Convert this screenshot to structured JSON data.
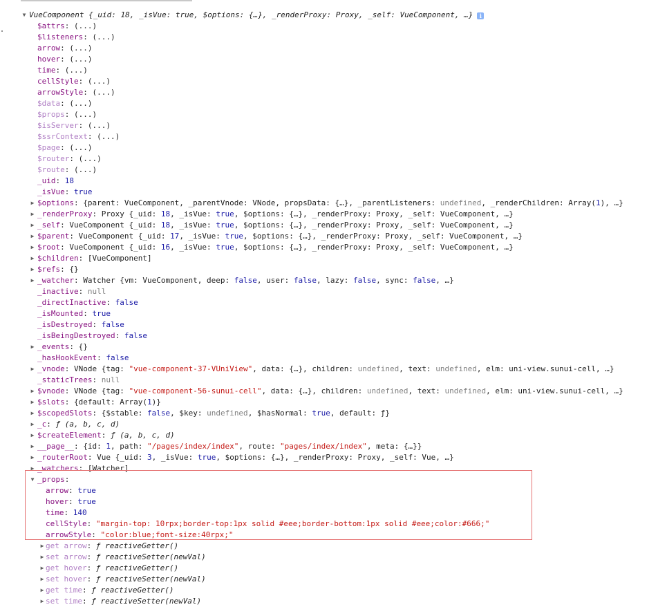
{
  "header": {
    "class_name": "VueComponent",
    "summary_tail": " {_uid: 18, _isVue: true, $options: {…}, _renderProxy: Proxy, _self: VueComponent, …}"
  },
  "lazy_value": "(...)",
  "rows": [
    {
      "key": "$attrs",
      "kind": "lazy"
    },
    {
      "key": "$listeners",
      "kind": "lazy"
    },
    {
      "key": "arrow",
      "kind": "lazy"
    },
    {
      "key": "hover",
      "kind": "lazy"
    },
    {
      "key": "time",
      "kind": "lazy"
    },
    {
      "key": "cellStyle",
      "kind": "lazy"
    },
    {
      "key": "arrowStyle",
      "kind": "lazy"
    },
    {
      "key": "$data",
      "kind": "lazy"
    },
    {
      "key": "$props",
      "kind": "lazy"
    },
    {
      "key": "$isServer",
      "kind": "lazy"
    },
    {
      "key": "$ssrContext",
      "kind": "lazy"
    },
    {
      "key": "$page",
      "kind": "lazy"
    },
    {
      "key": "$router",
      "kind": "lazy"
    },
    {
      "key": "$route",
      "kind": "lazy"
    },
    {
      "key": "_uid",
      "value": "18"
    },
    {
      "key": "_isVue",
      "value": "true"
    },
    {
      "key": "$options",
      "value": "{parent: VueComponent, _parentVnode: VNode, propsData: {…}, _parentListeners: undefined, _renderChildren: Array(1), …}"
    },
    {
      "key": "_renderProxy",
      "value": "Proxy {_uid: 18, _isVue: true, $options: {…}, _renderProxy: Proxy, _self: VueComponent, …}"
    },
    {
      "key": "_self",
      "value": "VueComponent {_uid: 18, _isVue: true, $options: {…}, _renderProxy: Proxy, _self: VueComponent, …}"
    },
    {
      "key": "$parent",
      "value": "VueComponent {_uid: 17, _isVue: true, $options: {…}, _renderProxy: Proxy, _self: VueComponent, …}"
    },
    {
      "key": "$root",
      "value": "VueComponent {_uid: 16, _isVue: true, $options: {…}, _renderProxy: Proxy, _self: VueComponent, …}"
    },
    {
      "key": "$children",
      "value": "[VueComponent]"
    },
    {
      "key": "$refs",
      "value": "{}"
    },
    {
      "key": "_watcher",
      "value": "Watcher {vm: VueComponent, deep: false, user: false, lazy: false, sync: false, …}"
    },
    {
      "key": "_inactive",
      "value": "null"
    },
    {
      "key": "_directInactive",
      "value": "false"
    },
    {
      "key": "_isMounted",
      "value": "true"
    },
    {
      "key": "_isDestroyed",
      "value": "false"
    },
    {
      "key": "_isBeingDestroyed",
      "value": "false"
    },
    {
      "key": "_events",
      "value": "{}"
    },
    {
      "key": "_hasHookEvent",
      "value": "false"
    },
    {
      "key": "_vnode",
      "value": "VNode {tag: \"vue-component-37-VUniView\", data: {…}, children: undefined, text: undefined, elm: uni-view.sunui-cell, …}"
    },
    {
      "key": "_staticTrees",
      "value": "null"
    },
    {
      "key": "$vnode",
      "value": "VNode {tag: \"vue-component-56-sunui-cell\", data: {…}, children: undefined, text: undefined, elm: uni-view.sunui-cell, …}"
    },
    {
      "key": "$slots",
      "value": "{default: Array(1)}"
    },
    {
      "key": "$scopedSlots",
      "value": "{$stable: false, $key: undefined, $hasNormal: true, default: ƒ}"
    },
    {
      "key": "_c",
      "value": "ƒ (a, b, c, d)"
    },
    {
      "key": "$createElement",
      "value": "ƒ (a, b, c, d)"
    },
    {
      "key": "__page__",
      "value": "{id: 1, path: \"/pages/index/index\", route: \"pages/index/index\", meta: {…}}"
    },
    {
      "key": "_routerRoot",
      "value": "Vue {_uid: 3, _isVue: true, $options: {…}, _renderProxy: Proxy, _self: Vue, …}"
    },
    {
      "key": "_watchers",
      "value": "[Watcher]"
    },
    {
      "key": "_props",
      "value": ""
    },
    {
      "key": "arrow",
      "value": "true"
    },
    {
      "key": "hover",
      "value": "true"
    },
    {
      "key": "time",
      "value": "140"
    },
    {
      "key": "cellStyle",
      "value": "\"margin-top: 10rpx;border-top:1px solid #eee;border-bottom:1px solid #eee;color:#666;\""
    },
    {
      "key": "arrowStyle",
      "value": "\"color:blue;font-size:40rpx;\""
    },
    {
      "key": "get arrow",
      "value": "ƒ reactiveGetter()"
    },
    {
      "key": "set arrow",
      "value": "ƒ reactiveSetter(newVal)"
    },
    {
      "key": "get hover",
      "value": "ƒ reactiveGetter()"
    },
    {
      "key": "set hover",
      "value": "ƒ reactiveSetter(newVal)"
    },
    {
      "key": "get time",
      "value": "ƒ reactiveGetter()"
    },
    {
      "key": "set time",
      "value": "ƒ reactiveSetter(newVal)"
    }
  ]
}
